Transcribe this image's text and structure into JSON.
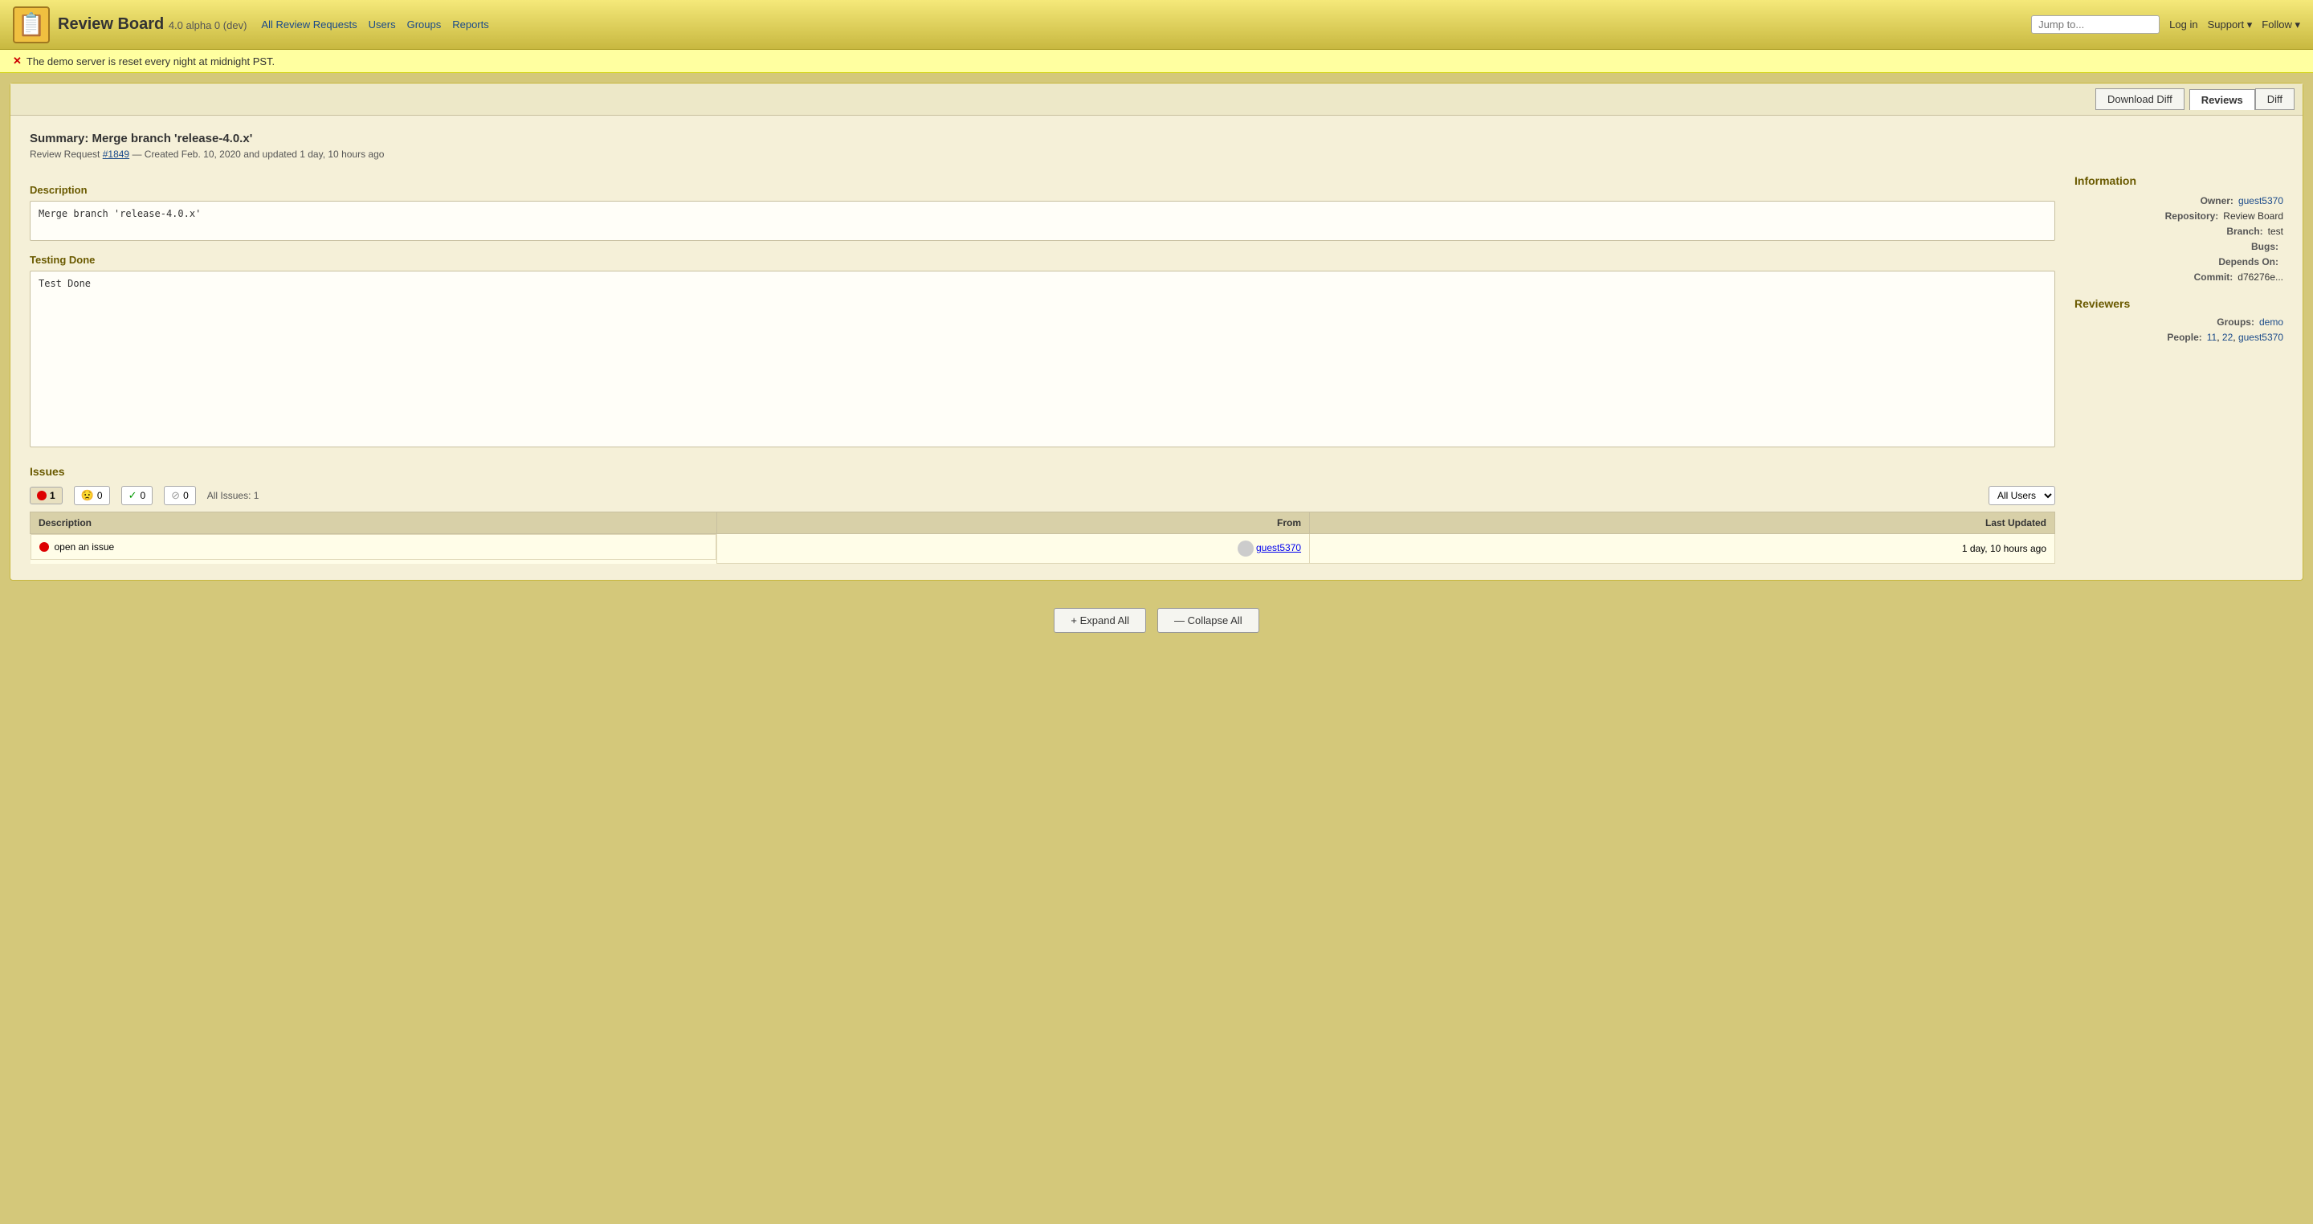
{
  "app": {
    "title": "Review Board",
    "version": "4.0 alpha 0 (dev)",
    "logo_emoji": "📋"
  },
  "nav": {
    "all_review_requests": "All Review Requests",
    "users": "Users",
    "groups": "Groups",
    "reports": "Reports"
  },
  "top_right": {
    "jump_placeholder": "Jump to...",
    "login": "Log in",
    "support": "Support",
    "follow": "Follow"
  },
  "demo_banner": {
    "message": "The demo server is reset every night at midnight PST."
  },
  "toolbar": {
    "download_diff": "Download Diff",
    "reviews": "Reviews",
    "diff": "Diff"
  },
  "review": {
    "summary_label": "Summary:",
    "summary_value": "Merge branch 'release-4.0.x'",
    "request_label": "Review Request",
    "request_number": "#1849",
    "meta": "— Created Feb. 10, 2020 and updated 1 day, 10 hours ago",
    "description_label": "Description",
    "description_text": "Merge branch 'release-4.0.x'",
    "testing_label": "Testing Done",
    "testing_text": "Test Done"
  },
  "information": {
    "title": "Information",
    "owner_label": "Owner:",
    "owner_value": "guest5370",
    "repository_label": "Repository:",
    "repository_value": "Review Board",
    "branch_label": "Branch:",
    "branch_value": "test",
    "bugs_label": "Bugs:",
    "bugs_value": "",
    "depends_label": "Depends On:",
    "depends_value": "",
    "commit_label": "Commit:",
    "commit_value": "d76276e..."
  },
  "reviewers": {
    "title": "Reviewers",
    "groups_label": "Groups:",
    "groups_value": "demo",
    "people_label": "People:",
    "people_value": "11, 22, guest5370"
  },
  "issues": {
    "label": "Issues",
    "open_count": 1,
    "warning_count": 0,
    "resolved_count": 0,
    "dropped_count": 0,
    "all_label": "All Issues: 1",
    "user_select_default": "All Users",
    "table": {
      "col_description": "Description",
      "col_from": "From",
      "col_last_updated": "Last Updated",
      "rows": [
        {
          "status": "open",
          "description": "open an issue",
          "from": "guest5370",
          "last_updated": "1 day, 10 hours ago"
        }
      ]
    }
  },
  "bottom": {
    "expand_all": "+ Expand All",
    "collapse_all": "— Collapse All"
  }
}
